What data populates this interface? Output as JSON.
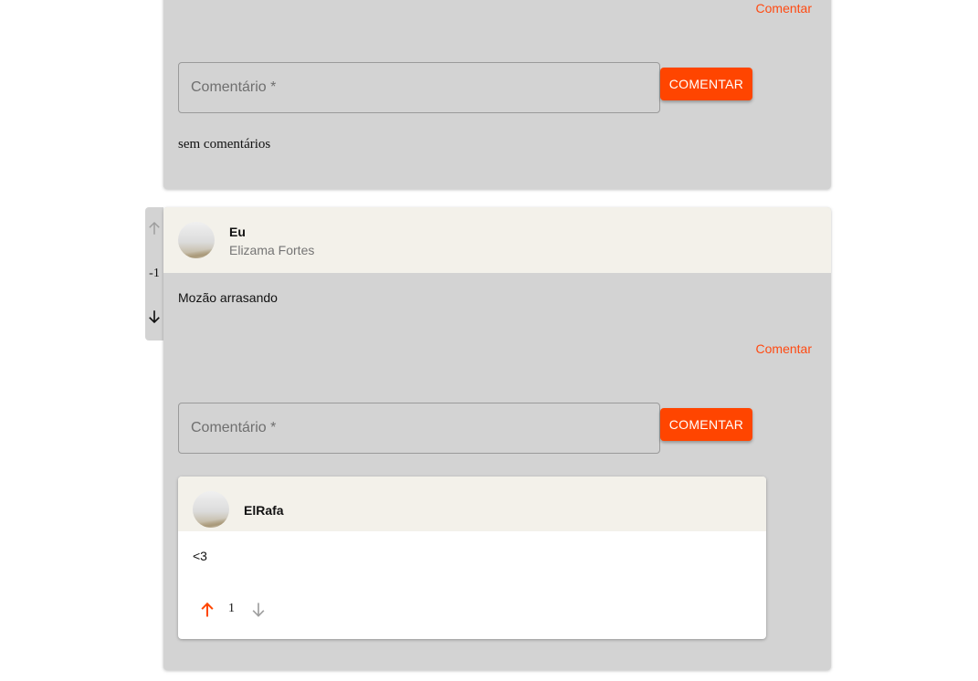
{
  "colors": {
    "accent": "#ff4500",
    "card_bg": "#d3d3d3",
    "header_bg": "#f3f1ea",
    "upvote_active": "#ff4500",
    "vote_inactive": "#9e9e9e"
  },
  "previous_post": {
    "comment_link": "Comentar",
    "comment_input": {
      "placeholder": "Comentário *",
      "value": ""
    },
    "comment_button": "COMENTAR",
    "no_comments": "sem comentários"
  },
  "post": {
    "votes": {
      "score": "-1",
      "up_icon": "arrow-up-icon",
      "down_icon": "arrow-down-icon"
    },
    "author": "Eu",
    "subtitle": "Elizama Fortes",
    "text": "Mozão arrasando",
    "comment_link": "Comentar",
    "comment_input": {
      "placeholder": "Comentário *",
      "value": ""
    },
    "comment_button": "COMENTAR",
    "replies": [
      {
        "author": "ElRafa",
        "text": "<3",
        "score": "1"
      }
    ]
  }
}
